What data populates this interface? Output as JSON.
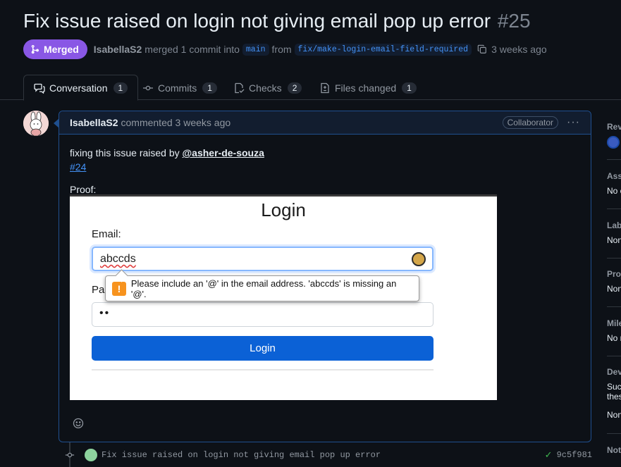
{
  "pr": {
    "title": "Fix issue raised on login not giving email pop up error",
    "number": "#25",
    "state_label": "Merged",
    "author": "IsabellaS2",
    "merge_text": "merged 1 commit into",
    "base_branch": "main",
    "from_text": "from",
    "head_branch": "fix/make-login-email-field-required",
    "merged_when": "3 weeks ago"
  },
  "tabs": [
    {
      "label": "Conversation",
      "count": "1",
      "icon": "comment-discussion-icon"
    },
    {
      "label": "Commits",
      "count": "1",
      "icon": "git-commit-icon"
    },
    {
      "label": "Checks",
      "count": "2",
      "icon": "checklist-icon"
    },
    {
      "label": "Files changed",
      "count": "1",
      "icon": "file-diff-icon"
    }
  ],
  "comment": {
    "author": "IsabellaS2",
    "when": "commented 3 weeks ago",
    "role": "Collaborator",
    "text_prefix": "fixing this issue raised by",
    "mention": "@asher-de-souza",
    "issue_ref": "#24",
    "proof_label": "Proof:"
  },
  "screenshot": {
    "heading": "Login",
    "email_label": "Email:",
    "email_value": "abccds",
    "password_label": "Pas",
    "password_value": "••",
    "validation_message": "Please include an '@' in the email address. 'abccds' is missing an '@'.",
    "button_label": "Login"
  },
  "commit": {
    "message": "Fix issue raised on login not giving email pop up error",
    "sha": "9c5f981",
    "status": "success"
  },
  "sidebar": {
    "sections": [
      {
        "heading": "Rev",
        "value": ""
      },
      {
        "heading": "Ass",
        "value": "No c"
      },
      {
        "heading": "Lab",
        "value": "Non"
      },
      {
        "heading": "Proj",
        "value": "Non"
      },
      {
        "heading": "Mile",
        "value": "No r"
      },
      {
        "heading": "Dev",
        "value": "Succ",
        "value2": "thes",
        "value3": "Non"
      },
      {
        "heading": "Noti",
        "value": ""
      }
    ]
  },
  "colors": {
    "background": "#0d1117",
    "merged": "#8957e5",
    "link": "#4493f8",
    "success": "#3fb950"
  }
}
